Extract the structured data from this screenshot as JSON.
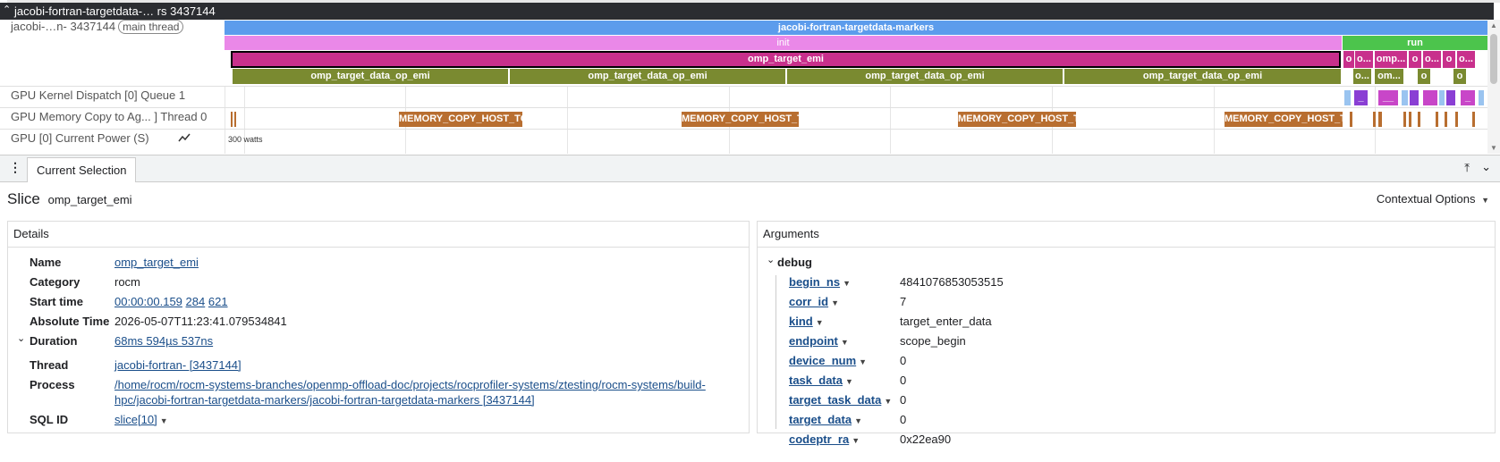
{
  "trace": {
    "group_title": "jacobi-fortran-targetdata-…  rs 3437144",
    "thread_label": "jacobi-…n- 3437144",
    "thread_badge": "main thread",
    "row_root": "jacobi-fortran-targetdata-markers",
    "row_init": "init",
    "row_run": "run",
    "row_emi": "omp_target_emi",
    "op_emi": [
      "omp_target_data_op_emi",
      "omp_target_data_op_emi",
      "omp_target_data_op_emi",
      "omp_target_data_op_emi"
    ],
    "run_small1": [
      "o",
      "o...",
      "omp...",
      "o",
      "o...",
      "o",
      "o..."
    ],
    "run_small2": [
      "o...",
      "om...",
      "o",
      "o"
    ],
    "kernel_label": "GPU Kernel Dispatch [0] Queue 1",
    "kernel_marks": [
      "_",
      "__",
      "_"
    ],
    "memcopy_label": "GPU Memory Copy to Ag... ] Thread 0",
    "memcopy_slices": [
      "MEMORY_COPY_HOST_TO_D...",
      "MEMORY_COPY_HOST_TO_...",
      "MEMORY_COPY_HOST_TO_...",
      "MEMORY_COPY_HOST_TO_..."
    ],
    "power_label": "GPU [0] Current Power (S)",
    "power_value": "300 watts",
    "colors": {
      "root": "#5c9cec",
      "init": "#ea88e8",
      "run": "#4cc44c",
      "emi": "#c8308c",
      "op": "#7a8a30",
      "memcopy": "#b86e30",
      "kernel_light": "#9ac4f0",
      "kernel_purple": "#8a3fd4",
      "kernel_magenta": "#c846c8"
    }
  },
  "tabs": {
    "current": "Current Selection"
  },
  "slice": {
    "heading": "Slice",
    "name": "omp_target_emi",
    "contextual": "Contextual Options"
  },
  "details": {
    "title": "Details",
    "name_k": "Name",
    "name_v": "omp_target_emi",
    "category_k": "Category",
    "category_v": "rocm",
    "start_k": "Start time",
    "start_v1": "00:00:00.159",
    "start_v2": "284",
    "start_v3": "621",
    "abs_k": "Absolute Time",
    "abs_v": "2026-05-07T11:23:41.079534841",
    "dur_k": "Duration",
    "dur_v": "68ms 594µs 537ns",
    "thread_k": "Thread",
    "thread_v": "jacobi-fortran- [3437144]",
    "process_k": "Process",
    "process_v1": "/home/rocm/rocm-systems-branches/openmp-offload-doc/projects/rocprofiler-systems/ztesting/rocm-systems/build-",
    "process_v2": "hpc/jacobi-fortran-targetdata-markers/jacobi-fortran-targetdata-markers [3437144]",
    "sqlid_k": "SQL ID",
    "sqlid_v": "slice[10]"
  },
  "arguments": {
    "title": "Arguments",
    "group": "debug",
    "items": [
      {
        "key": "begin_ns",
        "value": "4841076853053515"
      },
      {
        "key": "corr_id",
        "value": "7"
      },
      {
        "key": "kind",
        "value": "target_enter_data"
      },
      {
        "key": "endpoint",
        "value": "scope_begin"
      },
      {
        "key": "device_num",
        "value": "0"
      },
      {
        "key": "task_data",
        "value": "0"
      },
      {
        "key": "target_task_data",
        "value": "0"
      },
      {
        "key": "target_data",
        "value": "0"
      },
      {
        "key": "codeptr_ra",
        "value": "0x22ea90"
      }
    ]
  }
}
